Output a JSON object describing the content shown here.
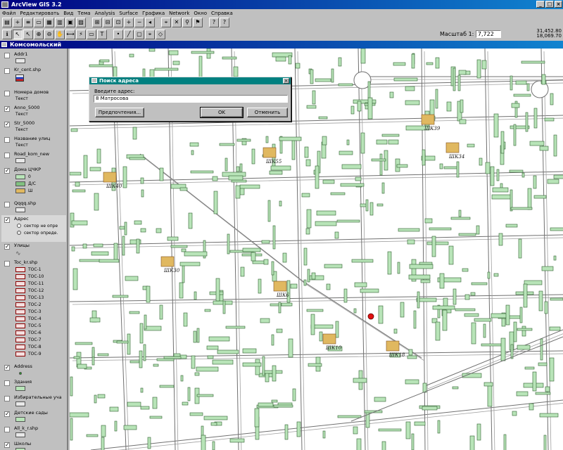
{
  "app": {
    "title": "ArcView GIS 3.2"
  },
  "menu": [
    "Файл",
    "Редактировать",
    "Вид",
    "Тема",
    "Analysis",
    "Surface",
    "Графика",
    "Network",
    "Окно",
    "Справка"
  ],
  "toolbar": {
    "scale_label": "Масштаб 1:",
    "scale_value": "7,722",
    "coord_x": "31,452.80",
    "coord_y": "18,069.70"
  },
  "view": {
    "title": "Комсомольский"
  },
  "toc": {
    "layers": [
      {
        "name": "Addr1",
        "checked": false
      },
      {
        "name": "Kr_cent.shp",
        "checked": false
      },
      {
        "name": "Номера домов",
        "checked": false,
        "sub": "Текст"
      },
      {
        "name": "Anno_5000",
        "checked": true,
        "sub": "Текст"
      },
      {
        "name": "Str_5000",
        "checked": true,
        "sub": "Текст"
      },
      {
        "name": "Название улиц",
        "checked": false,
        "sub": "Текст"
      },
      {
        "name": "Road_kom_new",
        "checked": false
      },
      {
        "name": "Дома ЦЧКР",
        "checked": true,
        "legend": [
          "0",
          "Д/С",
          "Ш"
        ]
      },
      {
        "name": "Qqqq.shp",
        "checked": false
      },
      {
        "name": "Адрес",
        "checked": true,
        "legend": [
          "сектор не опре",
          "сектор опреде."
        ]
      },
      {
        "name": "Улицы",
        "checked": true
      },
      {
        "name": "Toc_kr.shp",
        "checked": false,
        "legend": [
          "ТОС-1",
          "ТОС-10",
          "ТОС-11",
          "ТОС-12",
          "ТОС-13",
          "ТОС-2",
          "ТОС-3",
          "ТОС-4",
          "ТОС-5",
          "ТОС-6",
          "ТОС-7",
          "ТОС-8",
          "ТОС-9"
        ]
      },
      {
        "name": "Address",
        "checked": true
      },
      {
        "name": "Здания",
        "checked": false
      },
      {
        "name": "Избирательные уча",
        "checked": false
      },
      {
        "name": "Детские сады",
        "checked": true
      },
      {
        "name": "All_k_r.shp",
        "checked": false
      },
      {
        "name": "Школы",
        "checked": true
      },
      {
        "name": "Str_cache",
        "checked": false
      }
    ]
  },
  "map": {
    "labels": [
      "ШК55",
      "ШК39",
      "ШК34",
      "ШК40",
      "ШК30",
      "ШК6",
      "ШК18",
      "ШК10"
    ]
  },
  "dialog": {
    "title": "Поиск адреса",
    "prompt": "Введите адрес:",
    "value": "8 Матросова",
    "btn_prefs": "Предпочтения...",
    "btn_ok": "OK",
    "btn_cancel": "Отменить",
    "close": "×"
  },
  "colors": {
    "building_fill": "#b8e4b8",
    "school_fill": "#e0b860",
    "street": "#707070",
    "marker": "#e01010"
  }
}
